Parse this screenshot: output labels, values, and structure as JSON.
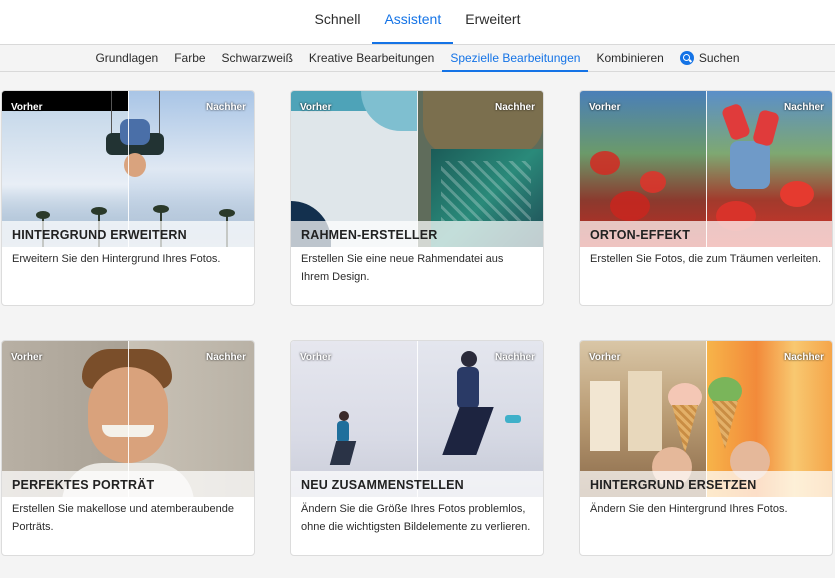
{
  "top_tabs": [
    {
      "label": "Schnell",
      "active": false
    },
    {
      "label": "Assistent",
      "active": true
    },
    {
      "label": "Erweitert",
      "active": false
    }
  ],
  "sub_tabs": [
    {
      "label": "Grundlagen",
      "active": false
    },
    {
      "label": "Farbe",
      "active": false
    },
    {
      "label": "Schwarzweiß",
      "active": false
    },
    {
      "label": "Kreative Bearbeitungen",
      "active": false
    },
    {
      "label": "Spezielle Bearbeitungen",
      "active": true
    },
    {
      "label": "Kombinieren",
      "active": false
    },
    {
      "label": "Suchen",
      "active": false,
      "icon": "search-icon"
    }
  ],
  "before_label": "Vorher",
  "after_label": "Nachher",
  "cards": [
    {
      "title": "HINTERGRUND ERWEITERN",
      "description": "Erweitern Sie den Hintergrund Ihres Fotos."
    },
    {
      "title": "RAHMEN-ERSTELLER",
      "description": "Erstellen Sie eine neue Rahmendatei aus Ihrem Design."
    },
    {
      "title": "ORTON-EFFEKT",
      "description": "Erstellen Sie Fotos, die zum Träumen verleiten."
    },
    {
      "title": "PERFEKTES PORTRÄT",
      "description": "Erstellen Sie makellose und atemberaubende Porträts."
    },
    {
      "title": "NEU ZUSAMMENSTELLEN",
      "description": "Ändern Sie die Größe Ihres Fotos problemlos, ohne die wichtigsten Bildelemente zu verlieren."
    },
    {
      "title": "HINTERGRUND ERSETZEN",
      "description": "Ändern Sie den Hintergrund Ihres Fotos."
    }
  ],
  "colors": {
    "accent": "#1473e6"
  }
}
